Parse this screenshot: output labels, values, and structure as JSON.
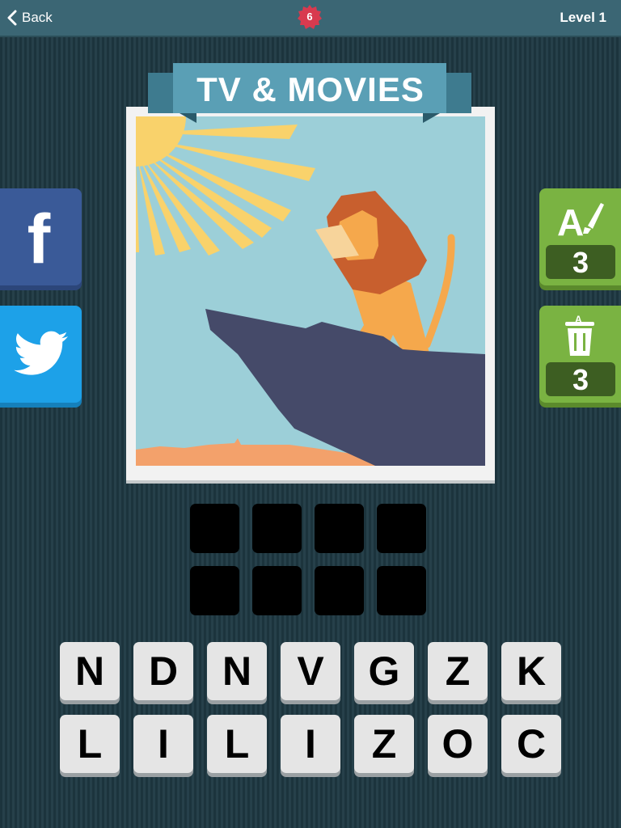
{
  "header": {
    "back_label": "Back",
    "coins": "6",
    "level": "Level 1"
  },
  "category": "TV & MOVIES",
  "social": {
    "facebook_glyph": "f"
  },
  "hints": [
    {
      "name": "reveal-letter",
      "icon": "letter-brush-icon",
      "count": "3"
    },
    {
      "name": "remove-letters",
      "icon": "trash-letter-icon",
      "count": "3"
    }
  ],
  "answer_slots": 8,
  "letters": [
    "N",
    "D",
    "N",
    "V",
    "G",
    "Z",
    "K",
    "L",
    "I",
    "L",
    "I",
    "Z",
    "O",
    "C"
  ],
  "colors": {
    "accent_red": "#d83a4f",
    "banner": "#5a9fb5",
    "hint_green": "#7ab342",
    "facebook": "#3a5a98",
    "twitter": "#1da1e8"
  }
}
